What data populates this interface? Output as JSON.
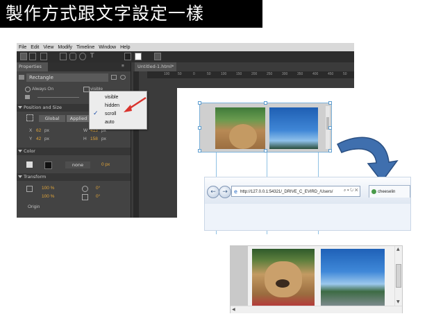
{
  "banner": {
    "title": "製作方式跟文字設定一樣"
  },
  "editor": {
    "menu": [
      "File",
      "Edit",
      "View",
      "Modify",
      "Timeline",
      "Window",
      "Help"
    ],
    "properties_tab": "Properties",
    "panel_options": "≡",
    "element_name": "Rectangle",
    "always_on": "Always On",
    "overflow_label": "visible",
    "sections": {
      "position": "Position and Size",
      "color": "Color",
      "transform": "Transform"
    },
    "pos_buttons": {
      "global": "Global",
      "applied": "Applied"
    },
    "x_label": "X",
    "x_value": "62",
    "x_unit": "px",
    "y_label": "Y",
    "y_value": "42",
    "y_unit": "px",
    "w_label": "W",
    "w_value": "413",
    "w_unit": "px",
    "h_label": "H",
    "h_value": "158",
    "h_unit": "px",
    "color_none": "none",
    "color_px": "0 px",
    "scale_x": "100 %",
    "scale_y": "100 %",
    "rotate": "0°",
    "skew": "0°",
    "origin": "Origin",
    "stage_tab": "Untitled-1.html*",
    "ruler_ticks": [
      "100",
      "50",
      "0",
      "50",
      "100",
      "150",
      "200",
      "250",
      "300",
      "350",
      "400",
      "450",
      "50"
    ],
    "dropdown": {
      "options": [
        "visible",
        "hidden",
        "scroll",
        "auto"
      ],
      "selected": "scroll",
      "checkmark": "✓"
    }
  },
  "browser": {
    "back": "←",
    "forward": "→",
    "url": "http://127.0.0.1:54321/_DRIVE_C_EVIRD_/Users/",
    "url_actions": "⌕ ▾ ↻ ✕",
    "tab_title": "cheeselin"
  },
  "colors": {
    "arrow": "#3f6fae",
    "arrow_stroke": "#2a4f82",
    "red_pointer": "#d9322c"
  }
}
